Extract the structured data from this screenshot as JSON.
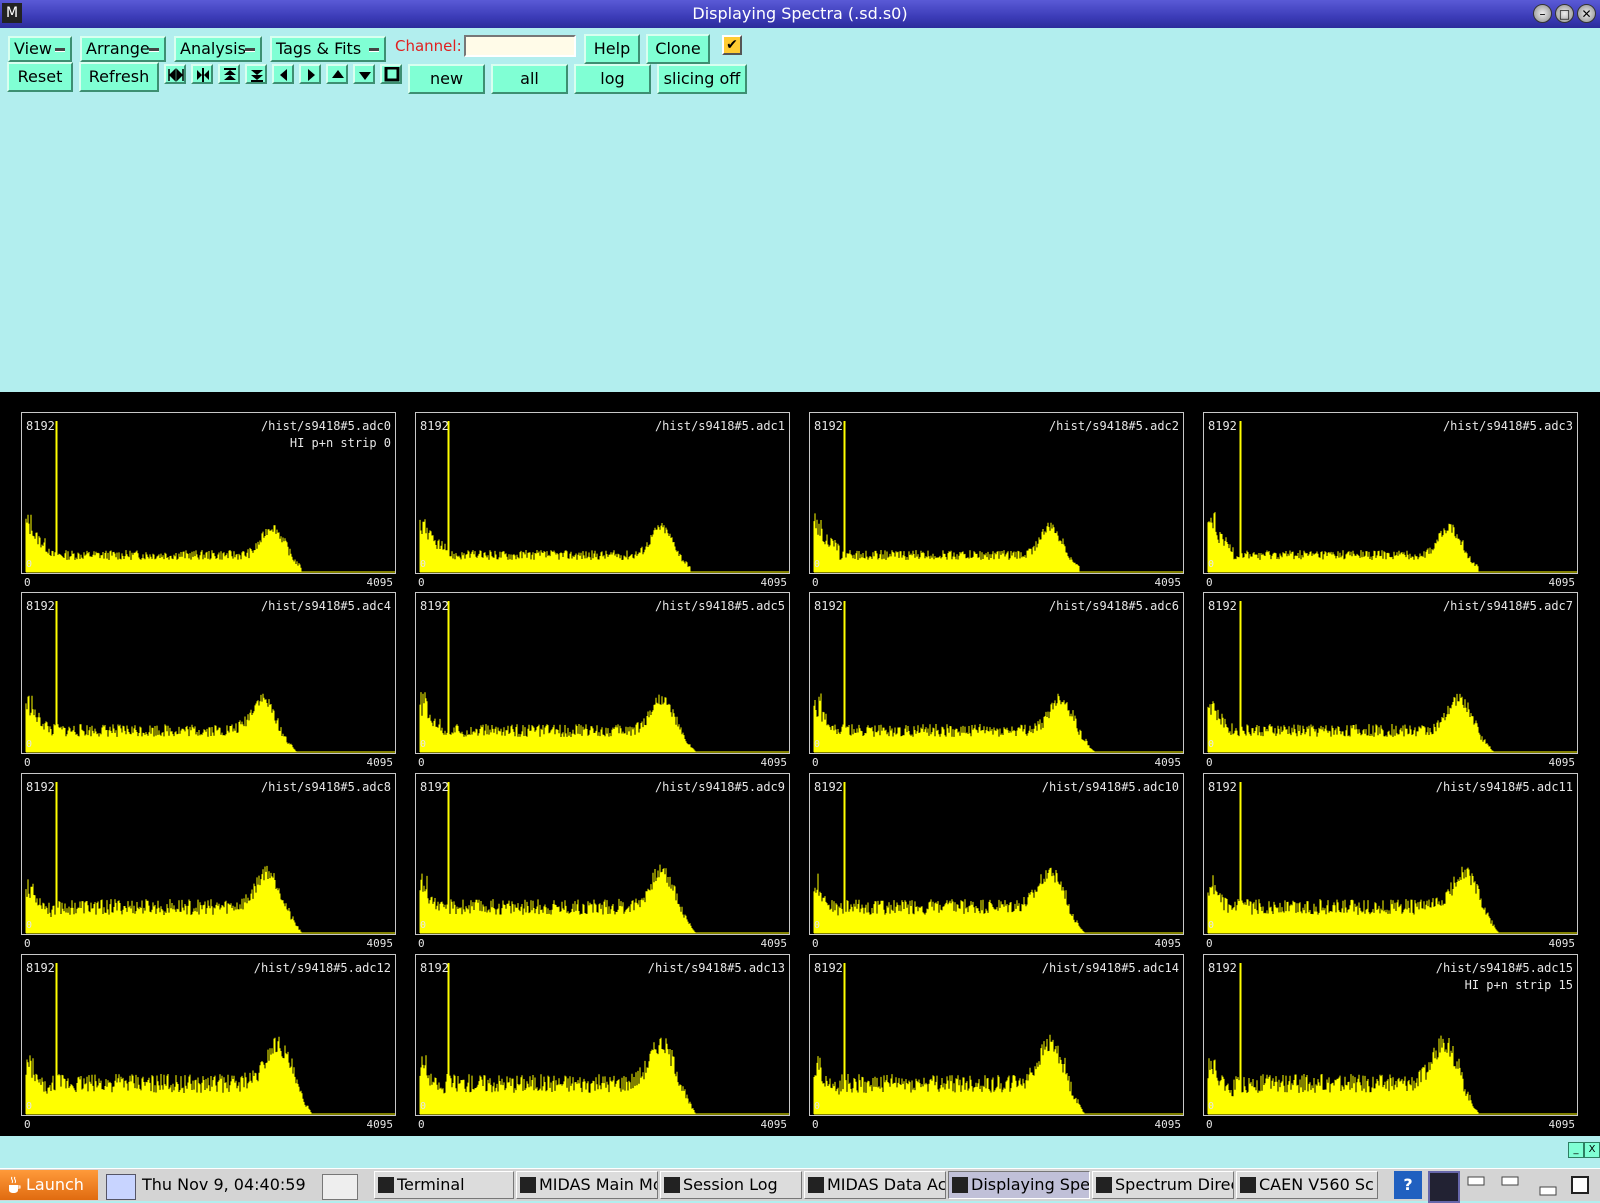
{
  "window": {
    "title": "Displaying Spectra (.sd.s0)",
    "icon": "midas-icon"
  },
  "menus": [
    {
      "label": "View"
    },
    {
      "label": "Arrange"
    },
    {
      "label": "Analysis"
    },
    {
      "label": "Tags & Fits"
    }
  ],
  "channel": {
    "label": "Channel:",
    "value": ""
  },
  "buttons": {
    "help": "Help",
    "clone": "Clone",
    "reset": "Reset",
    "refresh": "Refresh",
    "new": "new",
    "all": "all",
    "log": "log",
    "slicing": "slicing off"
  },
  "clone_checked": true,
  "nav_icons": [
    "expand-horizontal-icon",
    "compress-horizontal-icon",
    "expand-up-icon",
    "expand-down-icon",
    "arrow-left-icon",
    "arrow-right-icon",
    "arrow-up-icon",
    "arrow-down-icon",
    "stop-square-icon"
  ],
  "plot_color": "#ffff00",
  "panels": [
    {
      "name": "/hist/s9418#5.adc0",
      "subtitle": "HI p+n strip 0",
      "ymax": "8192",
      "xmin": "0",
      "xmax": "4095",
      "ymin": "0"
    },
    {
      "name": "/hist/s9418#5.adc1",
      "subtitle": "",
      "ymax": "8192",
      "xmin": "0",
      "xmax": "4095",
      "ymin": "0"
    },
    {
      "name": "/hist/s9418#5.adc2",
      "subtitle": "",
      "ymax": "8192",
      "xmin": "0",
      "xmax": "4095",
      "ymin": "0"
    },
    {
      "name": "/hist/s9418#5.adc3",
      "subtitle": "",
      "ymax": "8192",
      "xmin": "0",
      "xmax": "4095",
      "ymin": "0"
    },
    {
      "name": "/hist/s9418#5.adc4",
      "subtitle": "",
      "ymax": "8192",
      "xmin": "0",
      "xmax": "4095",
      "ymin": "0"
    },
    {
      "name": "/hist/s9418#5.adc5",
      "subtitle": "",
      "ymax": "8192",
      "xmin": "0",
      "xmax": "4095",
      "ymin": "0"
    },
    {
      "name": "/hist/s9418#5.adc6",
      "subtitle": "",
      "ymax": "8192",
      "xmin": "0",
      "xmax": "4095",
      "ymin": "0"
    },
    {
      "name": "/hist/s9418#5.adc7",
      "subtitle": "",
      "ymax": "8192",
      "xmin": "0",
      "xmax": "4095",
      "ymin": "0"
    },
    {
      "name": "/hist/s9418#5.adc8",
      "subtitle": "",
      "ymax": "8192",
      "xmin": "0",
      "xmax": "4095",
      "ymin": "0"
    },
    {
      "name": "/hist/s9418#5.adc9",
      "subtitle": "",
      "ymax": "8192",
      "xmin": "0",
      "xmax": "4095",
      "ymin": "0"
    },
    {
      "name": "/hist/s9418#5.adc10",
      "subtitle": "",
      "ymax": "8192",
      "xmin": "0",
      "xmax": "4095",
      "ymin": "0"
    },
    {
      "name": "/hist/s9418#5.adc11",
      "subtitle": "",
      "ymax": "8192",
      "xmin": "0",
      "xmax": "4095",
      "ymin": "0"
    },
    {
      "name": "/hist/s9418#5.adc12",
      "subtitle": "",
      "ymax": "8192",
      "xmin": "0",
      "xmax": "4095",
      "ymin": "0"
    },
    {
      "name": "/hist/s9418#5.adc13",
      "subtitle": "",
      "ymax": "8192",
      "xmin": "0",
      "xmax": "4095",
      "ymin": "0"
    },
    {
      "name": "/hist/s9418#5.adc14",
      "subtitle": "",
      "ymax": "8192",
      "xmin": "0",
      "xmax": "4095",
      "ymin": "0"
    },
    {
      "name": "/hist/s9418#5.adc15",
      "subtitle": "HI p+n strip 15",
      "ymax": "8192",
      "xmin": "0",
      "xmax": "4095",
      "ymin": "0"
    }
  ],
  "taskbar": {
    "launch": "Launch",
    "clock": "Thu Nov  9, 04:40:59",
    "tasks": [
      {
        "label": "Terminal"
      },
      {
        "label": "MIDAS Main Mo"
      },
      {
        "label": "Session Log"
      },
      {
        "label": "MIDAS Data Ac"
      },
      {
        "label": "Displaying Spe"
      },
      {
        "label": "Spectrum Direc"
      },
      {
        "label": "CAEN V560 Sc"
      }
    ],
    "tray_icons": [
      "help-icon",
      "midas-icon",
      "window-icon",
      "window-icon",
      "minimize-icon",
      "window-icon"
    ]
  }
}
